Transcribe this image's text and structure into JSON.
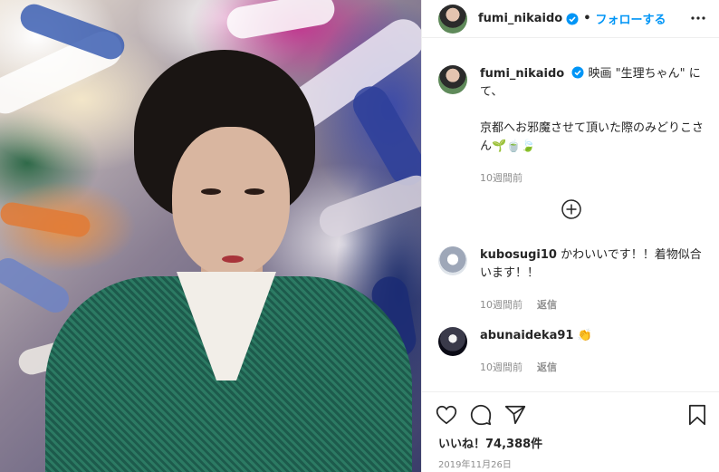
{
  "header": {
    "username": "fumi_nikaido",
    "separator": "•",
    "follow_label": "フォローする"
  },
  "caption": {
    "username": "fumi_nikaido",
    "text_line1": "映画 \"生理ちゃん\" にて、",
    "text_line2": "京都へお邪魔させて頂いた際のみどりこさん🌱🍵🍃",
    "time": "10週間前"
  },
  "comments": [
    {
      "username": "kubosugi10",
      "text": "かわいいです！！着物似合います！！",
      "time": "10週間前",
      "reply_label": "返信"
    },
    {
      "username": "abunaideka91",
      "text": "👏",
      "time": "10週間前",
      "reply_label": "返信"
    }
  ],
  "footer": {
    "likes": "いいね！74,388件",
    "date": "2019年11月26日"
  },
  "colors": {
    "accent": "#0095f6",
    "text": "#262626",
    "muted": "#8e8e8e"
  },
  "icons": [
    "verified-badge-icon",
    "more-options-icon",
    "add-circle-icon",
    "heart-icon",
    "comment-icon",
    "share-icon",
    "bookmark-icon"
  ]
}
